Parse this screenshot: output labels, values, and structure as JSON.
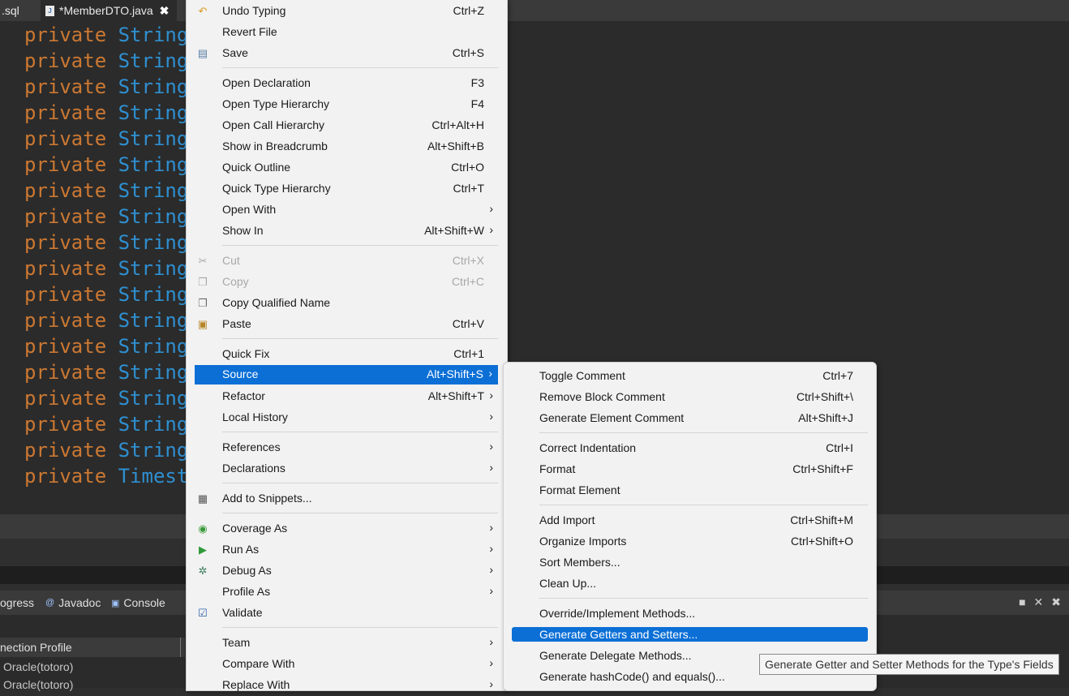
{
  "tabs": {
    "sql_tab": ".sql",
    "active_tab": "*MemberDTO.java",
    "close_glyph": "✖"
  },
  "editor": {
    "lines": [
      {
        "keyword": "private",
        "type": "String"
      },
      {
        "keyword": "private",
        "type": "String"
      },
      {
        "keyword": "private",
        "type": "String"
      },
      {
        "keyword": "private",
        "type": "String"
      },
      {
        "keyword": "private",
        "type": "String"
      },
      {
        "keyword": "private",
        "type": "String"
      },
      {
        "keyword": "private",
        "type": "String"
      },
      {
        "keyword": "private",
        "type": "String"
      },
      {
        "keyword": "private",
        "type": "String"
      },
      {
        "keyword": "private",
        "type": "String"
      },
      {
        "keyword": "private",
        "type": "String"
      },
      {
        "keyword": "private",
        "type": "String"
      },
      {
        "keyword": "private",
        "type": "String"
      },
      {
        "keyword": "private",
        "type": "String"
      },
      {
        "keyword": "private",
        "type": "String"
      },
      {
        "keyword": "private",
        "type": "String"
      },
      {
        "keyword": "private",
        "type": "String"
      },
      {
        "keyword": "private",
        "type": "Timest"
      }
    ],
    "colors": {
      "keyword": "#cc7832",
      "type": "#2f8fd0",
      "background": "#2b2b2b"
    }
  },
  "bottom_view": {
    "tabs": [
      "ogress",
      "Javadoc",
      "Console"
    ],
    "column_header": "nection Profile",
    "rows": [
      "Oracle(totoro)",
      "Oracle(totoro)"
    ]
  },
  "context_menu": {
    "items": [
      {
        "label": "Undo Typing",
        "shortcut": "Ctrl+Z",
        "icon": "undo-icon"
      },
      {
        "label": "Revert File",
        "shortcut": ""
      },
      {
        "label": "Save",
        "shortcut": "Ctrl+S",
        "icon": "save-icon"
      },
      {
        "label": "Open Declaration",
        "shortcut": "F3"
      },
      {
        "label": "Open Type Hierarchy",
        "shortcut": "F4"
      },
      {
        "label": "Open Call Hierarchy",
        "shortcut": "Ctrl+Alt+H"
      },
      {
        "label": "Show in Breadcrumb",
        "shortcut": "Alt+Shift+B"
      },
      {
        "label": "Quick Outline",
        "shortcut": "Ctrl+O"
      },
      {
        "label": "Quick Type Hierarchy",
        "shortcut": "Ctrl+T"
      },
      {
        "label": "Open With",
        "shortcut": ""
      },
      {
        "label": "Show In",
        "shortcut": "Alt+Shift+W"
      },
      {
        "label": "Cut",
        "shortcut": "Ctrl+X",
        "icon": "cut-icon"
      },
      {
        "label": "Copy",
        "shortcut": "Ctrl+C",
        "icon": "copy-icon"
      },
      {
        "label": "Copy Qualified Name",
        "shortcut": "",
        "icon": "copy-qualified-icon"
      },
      {
        "label": "Paste",
        "shortcut": "Ctrl+V",
        "icon": "paste-icon"
      },
      {
        "label": "Quick Fix",
        "shortcut": "Ctrl+1"
      },
      {
        "label": "Source",
        "shortcut": "Alt+Shift+S"
      },
      {
        "label": "Refactor",
        "shortcut": "Alt+Shift+T"
      },
      {
        "label": "Local History",
        "shortcut": ""
      },
      {
        "label": "References",
        "shortcut": ""
      },
      {
        "label": "Declarations",
        "shortcut": ""
      },
      {
        "label": "Add to Snippets...",
        "shortcut": "",
        "icon": "snippets-icon"
      },
      {
        "label": "Coverage As",
        "shortcut": "",
        "icon": "coverage-icon"
      },
      {
        "label": "Run As",
        "shortcut": "",
        "icon": "run-icon"
      },
      {
        "label": "Debug As",
        "shortcut": "",
        "icon": "debug-icon"
      },
      {
        "label": "Profile As",
        "shortcut": ""
      },
      {
        "label": "Validate",
        "shortcut": "",
        "icon": "checkbox-icon"
      },
      {
        "label": "Team",
        "shortcut": ""
      },
      {
        "label": "Compare With",
        "shortcut": ""
      },
      {
        "label": "Replace With",
        "shortcut": ""
      }
    ],
    "submenu_arrow": "›",
    "highlight_color": "#0b6fd6"
  },
  "source_submenu": {
    "items": [
      {
        "label": "Toggle Comment",
        "shortcut": "Ctrl+7"
      },
      {
        "label": "Remove Block Comment",
        "shortcut": "Ctrl+Shift+\\"
      },
      {
        "label": "Generate Element Comment",
        "shortcut": "Alt+Shift+J"
      },
      {
        "label": "Correct Indentation",
        "shortcut": "Ctrl+I"
      },
      {
        "label": "Format",
        "shortcut": "Ctrl+Shift+F"
      },
      {
        "label": "Format Element",
        "shortcut": ""
      },
      {
        "label": "Add Import",
        "shortcut": "Ctrl+Shift+M"
      },
      {
        "label": "Organize Imports",
        "shortcut": "Ctrl+Shift+O"
      },
      {
        "label": "Sort Members...",
        "shortcut": ""
      },
      {
        "label": "Clean Up...",
        "shortcut": ""
      },
      {
        "label": "Override/Implement Methods...",
        "shortcut": ""
      },
      {
        "label": "Generate Getters and Setters...",
        "shortcut": ""
      },
      {
        "label": "Generate Delegate Methods...",
        "shortcut": ""
      },
      {
        "label": "Generate hashCode() and equals()...",
        "shortcut": ""
      }
    ]
  },
  "tooltip": {
    "text": "Generate Getter and Setter Methods for the Type's Fields"
  }
}
